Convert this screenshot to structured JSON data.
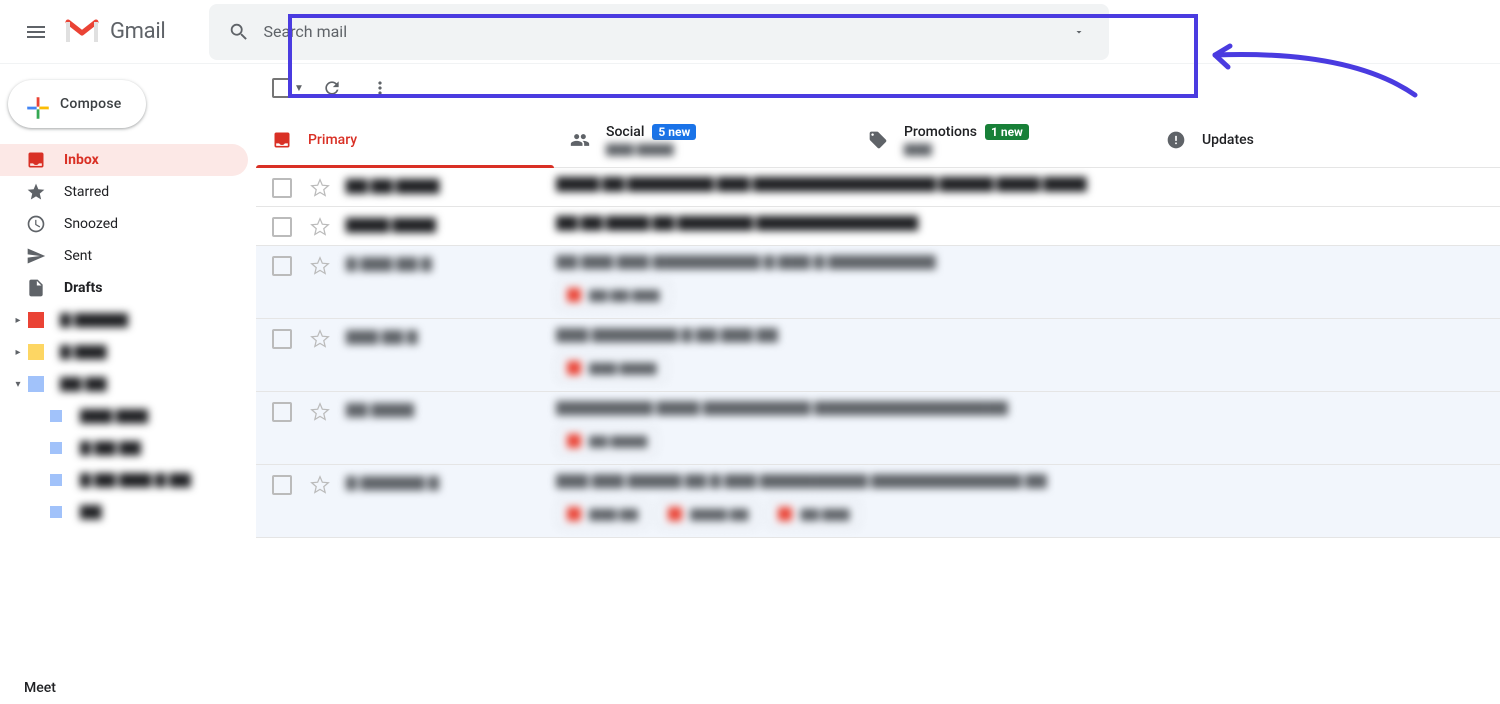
{
  "app_name": "Gmail",
  "search": {
    "placeholder": "Search mail"
  },
  "compose": {
    "label": "Compose"
  },
  "sidebar": {
    "items": [
      {
        "label": "Inbox"
      },
      {
        "label": "Starred"
      },
      {
        "label": "Snoozed"
      },
      {
        "label": "Sent"
      },
      {
        "label": "Drafts"
      }
    ],
    "labels": [
      {
        "color": "#ea4335",
        "text": "▇ ▇▇▇▇▇",
        "expand": "▸"
      },
      {
        "color": "#fdd663",
        "text": "▇ ▇▇▇",
        "expand": "▸"
      },
      {
        "color": "#a1c2fa",
        "text": "▇▇ ▇▇",
        "expand": "▾",
        "sub": [
          {
            "color": "#a1c2fa",
            "text": "▇▇▇ ▇▇▇"
          },
          {
            "color": "#a1c2fa",
            "text": "▇ ▇▇ ▇▇"
          },
          {
            "color": "#a1c2fa",
            "text": "▇ ▇▇ ▇▇▇ ▇ ▇▇"
          },
          {
            "color": "#a1c2fa",
            "text": "▇▇"
          }
        ]
      }
    ]
  },
  "tabs": [
    {
      "label": "Primary"
    },
    {
      "label": "Social",
      "badge": "5 new",
      "sub": "▇▇▇ ▇▇▇▇"
    },
    {
      "label": "Promotions",
      "badge": "1 new",
      "sub": "▇▇▇"
    },
    {
      "label": "Updates"
    }
  ],
  "rows": [
    {
      "sender": "▇▇ ▇▇ ▇▇▇▇",
      "subject": "▇▇▇▇ ▇▇ ▇▇▇▇▇▇▇▇ ▇▇▇ ▇▇▇▇▇▇▇▇▇▇▇▇▇▇▇▇▇ ▇▇▇▇▇ ▇▇▇▇ ▇▇▇▇",
      "read": false
    },
    {
      "sender": "▇▇▇▇ ▇▇▇▇",
      "subject": "▇▇ ▇▇ ▇▇▇▇ ▇▇ ▇▇▇▇▇▇▇ ▇▇▇▇▇▇▇▇▇▇▇▇▇▇▇",
      "read": false
    },
    {
      "sender": "▇ ▇▇▇ ▇▇ ▇",
      "subject": "▇▇ ▇▇▇ ▇▇▇ ▇▇▇▇▇▇▇▇▇▇ ▇ ▇▇▇ ▇ ▇▇▇▇▇▇▇▇▇▇",
      "read": true,
      "chips": [
        {
          "c": "#ea4335",
          "t": "▇▇ ▇▇ ▇▇▇"
        }
      ]
    },
    {
      "sender": "▇▇▇ ▇▇ ▇",
      "subject": "▇▇▇ ▇▇▇▇▇▇▇▇ ▇ ▇▇ ▇▇▇ ▇▇",
      "read": true,
      "chips": [
        {
          "c": "#ea4335",
          "t": "▇▇▇ ▇▇▇▇"
        }
      ]
    },
    {
      "sender": "▇▇ ▇▇▇▇",
      "subject": "▇▇▇▇▇▇▇▇▇ ▇▇▇▇ ▇▇▇▇▇▇▇▇▇▇ ▇▇▇▇▇▇▇▇▇▇▇▇▇▇▇▇▇▇",
      "read": true,
      "chips": [
        {
          "c": "#ea4335",
          "t": "▇▇ ▇▇▇▇"
        }
      ]
    },
    {
      "sender": "▇ ▇▇▇▇▇▇ ▇",
      "subject": "▇▇▇ ▇▇▇ ▇▇▇▇▇ ▇▇ ▇ ▇▇▇ ▇▇▇▇▇▇▇▇▇▇ ▇▇▇▇▇▇▇▇▇▇▇▇▇▇ ▇▇",
      "read": true,
      "chips": [
        {
          "c": "#ea4335",
          "t": "▇▇▇ ▇▇"
        },
        {
          "c": "#ea4335",
          "t": "▇▇▇▇ ▇▇"
        },
        {
          "c": "#ea4335",
          "t": "▇▇ ▇▇▇"
        }
      ]
    }
  ],
  "meet": {
    "label": "Meet"
  }
}
